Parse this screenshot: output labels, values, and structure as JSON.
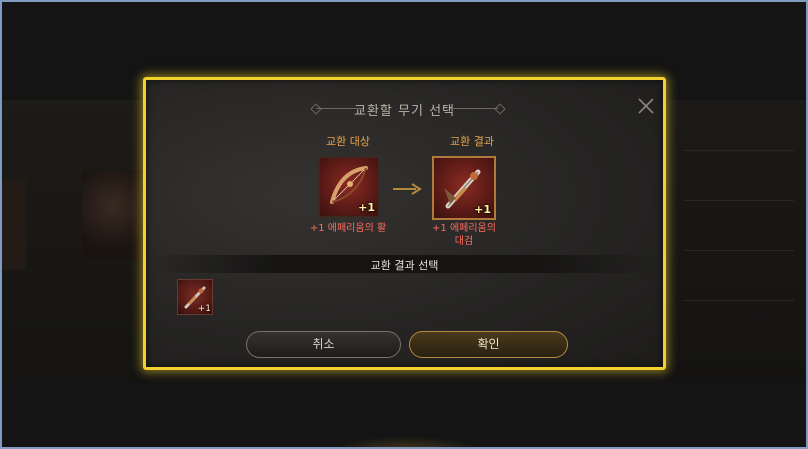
{
  "dialog": {
    "title": "교환할 무기 선택",
    "target_label": "교환 대상",
    "result_label": "교환 결과",
    "target_item": {
      "name": "+1 에페리움의 활",
      "enhance": "+1",
      "icon": "bow-icon"
    },
    "result_item": {
      "name_line1": "+1 에페리움의",
      "name_line2": "대검",
      "enhance": "+1",
      "icon": "greatsword-icon"
    },
    "section_label": "교환 결과 선택",
    "choices": [
      {
        "enhance": "+1",
        "icon": "greatsword-icon"
      }
    ],
    "cancel_label": "취소",
    "confirm_label": "확인"
  },
  "colors": {
    "border_highlight": "#f2d12f",
    "label_orange": "#e5a34a",
    "item_name_red": "#ff6a5a"
  }
}
